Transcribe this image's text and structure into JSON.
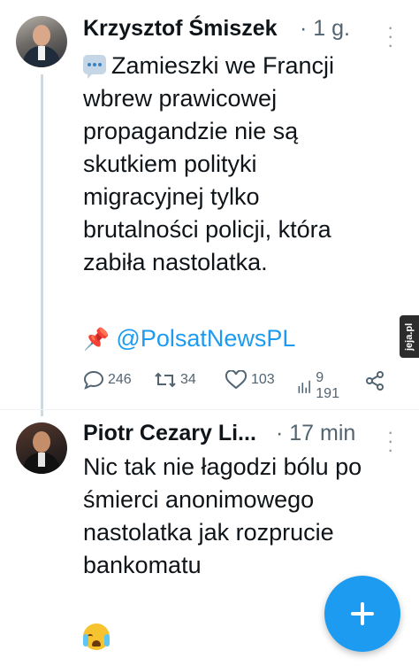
{
  "tweets": [
    {
      "author": "Krzysztof Śmiszek",
      "meta": "· 1 g.",
      "text_lines": [
        "Zamieszki we Francji",
        "wbrew prawicowej",
        "propagandzie nie są",
        "skutkiem polityki",
        "migracyjnej tylko",
        "brutalności policji, która",
        "zabiła nastolatka."
      ],
      "pin_emoji": "📌",
      "mention": "@PolsatNewsPL",
      "actions": {
        "replies": "246",
        "retweets": "34",
        "likes": "103",
        "views": "9 191"
      }
    },
    {
      "author": "Piotr Cezary Li...",
      "meta": "· 17 min",
      "text_lines": [
        "Nic tak nie łagodzi bólu po",
        "śmierci anonimowego",
        "nastolatka jak rozprucie",
        "bankomatu"
      ]
    }
  ],
  "watermark": "jeja.pl",
  "colors": {
    "link": "#1d9bf0",
    "fab": "#1d9bf0",
    "secondary_text": "#536471"
  },
  "icons": [
    "speech-bubble-icon",
    "pin-icon",
    "reply-icon",
    "retweet-icon",
    "like-icon",
    "views-icon",
    "share-icon",
    "more-icon",
    "compose-plus-icon",
    "crying-face-emoji"
  ]
}
